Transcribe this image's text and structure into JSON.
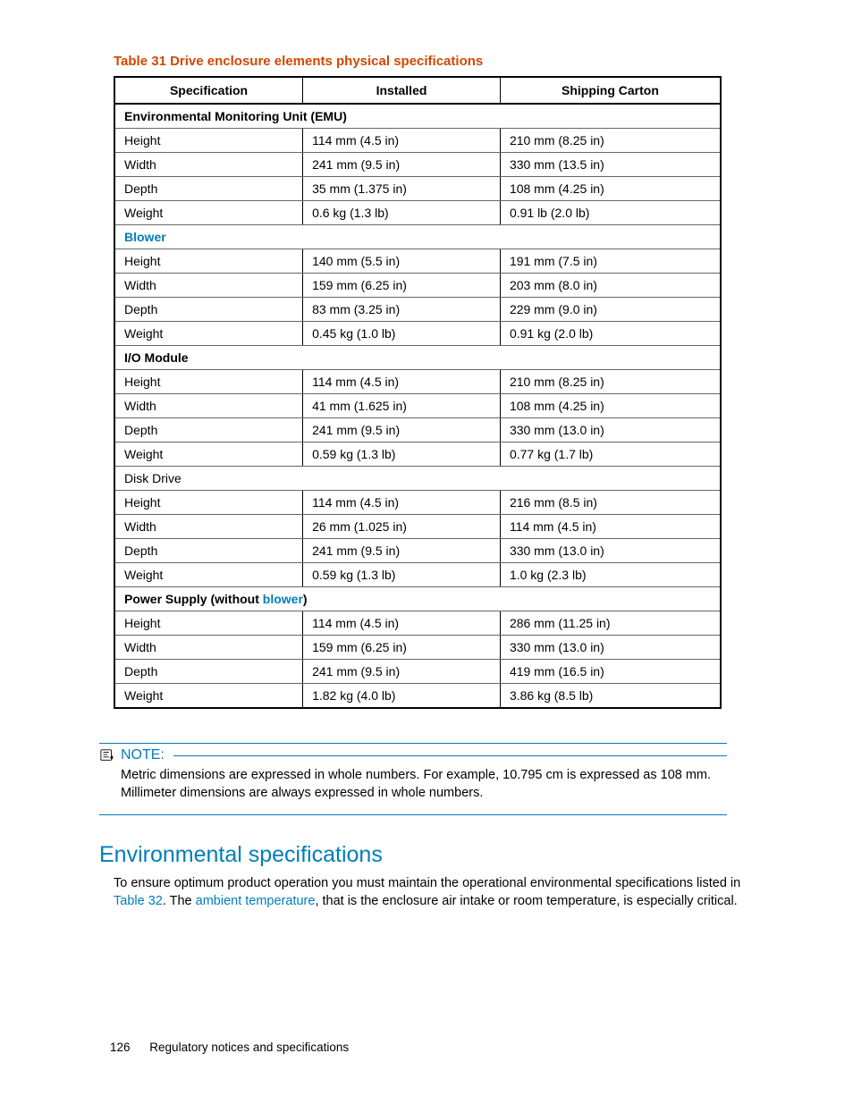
{
  "table": {
    "caption": "Table 31 Drive enclosure elements physical specifications",
    "headers": {
      "spec": "Specification",
      "installed": "Installed",
      "shipping": "Shipping Carton"
    },
    "sections": [
      {
        "title_html": "<b>Environmental Monitoring Unit (EMU)</b>",
        "rows": [
          {
            "spec": "Height",
            "installed": "114 mm (4.5 in)",
            "shipping": "210 mm (8.25 in)"
          },
          {
            "spec": "Width",
            "installed": "241 mm (9.5 in)",
            "shipping": "330 mm (13.5 in)"
          },
          {
            "spec": "Depth",
            "installed": "35 mm (1.375 in)",
            "shipping": "108 mm (4.25 in)"
          },
          {
            "spec": "Weight",
            "installed": "0.6 kg (1.3 lb)",
            "shipping": "0.91 lb (2.0 lb)"
          }
        ]
      },
      {
        "title_html": "<span class=\"glossary-link\">Blower</span>",
        "rows": [
          {
            "spec": "Height",
            "installed": "140 mm (5.5 in)",
            "shipping": "191 mm (7.5 in)"
          },
          {
            "spec": "Width",
            "installed": "159 mm (6.25 in)",
            "shipping": "203 mm (8.0 in)"
          },
          {
            "spec": "Depth",
            "installed": "83 mm (3.25 in)",
            "shipping": "229 mm (9.0 in)"
          },
          {
            "spec": "Weight",
            "installed": "0.45 kg (1.0 lb)",
            "shipping": "0.91 kg (2.0 lb)"
          }
        ]
      },
      {
        "title_html": "<b>I/O Module</b>",
        "rows": [
          {
            "spec": "Height",
            "installed": "114 mm (4.5 in)",
            "shipping": "210 mm (8.25 in)"
          },
          {
            "spec": "Width",
            "installed": "41 mm (1.625 in)",
            "shipping": "108 mm (4.25 in)"
          },
          {
            "spec": "Depth",
            "installed": "241 mm (9.5 in)",
            "shipping": "330 mm (13.0 in)"
          },
          {
            "spec": "Weight",
            "installed": "0.59 kg (1.3 lb)",
            "shipping": "0.77 kg (1.7 lb)"
          }
        ]
      },
      {
        "title_html": "<span class=\"normal-w\">Disk Drive</span>",
        "rows": [
          {
            "spec": "Height",
            "installed": "114 mm (4.5 in)",
            "shipping": "216 mm (8.5 in)"
          },
          {
            "spec": "Width",
            "installed": "26 mm (1.025 in)",
            "shipping": "114 mm (4.5 in)"
          },
          {
            "spec": "Depth",
            "installed": "241 mm (9.5 in)",
            "shipping": "330 mm (13.0 in)"
          },
          {
            "spec": "Weight",
            "installed": "0.59 kg (1.3 lb)",
            "shipping": "1.0 kg (2.3 lb)"
          }
        ]
      },
      {
        "title_html": "<b>Power Supply</b> (without <span class=\"glossary-link\">blower</span>)",
        "rows": [
          {
            "spec": "Height",
            "installed": "114 mm (4.5 in)",
            "shipping": "286 mm (11.25 in)"
          },
          {
            "spec": "Width",
            "installed": "159 mm (6.25 in)",
            "shipping": "330 mm (13.0 in)"
          },
          {
            "spec": "Depth",
            "installed": "241 mm (9.5 in)",
            "shipping": "419 mm (16.5 in)"
          },
          {
            "spec": "Weight",
            "installed": "1.82 kg (4.0 lb)",
            "shipping": "3.86 kg (8.5 lb)"
          }
        ]
      }
    ]
  },
  "note": {
    "label": "NOTE:",
    "text": "Metric dimensions are expressed in whole numbers. For example, 10.795 cm is expressed as 108 mm. Millimeter dimensions are always expressed in whole numbers."
  },
  "heading": "Environmental specifications",
  "para": {
    "pre": "To ensure optimum product operation you must maintain the operational environmental specifications listed in ",
    "link1": "Table 32",
    "mid": ".  The ",
    "link2": "ambient temperature",
    "post": ", that is the enclosure air intake or room temperature, is especially critical."
  },
  "footer": {
    "page": "126",
    "title": "Regulatory notices and specifications"
  }
}
